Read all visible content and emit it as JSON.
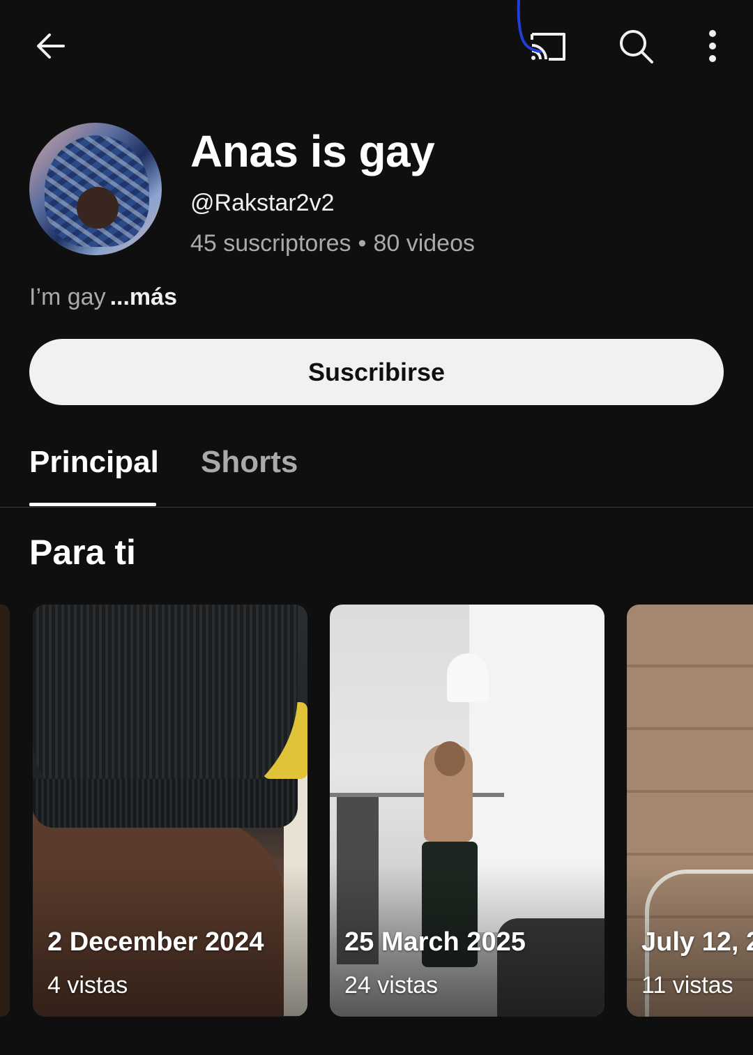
{
  "topbar": {
    "back_icon": "arrow-left-icon",
    "cast_icon": "cast-icon",
    "search_icon": "search-icon",
    "more_icon": "more-vertical-icon"
  },
  "channel": {
    "name": "Anas is gay",
    "handle": "@Rakstar2v2",
    "subscribers": "45 suscriptores",
    "separator": "•",
    "videos": "80 videos",
    "description": "I’m gay",
    "more_label": "...más"
  },
  "subscribe": {
    "label": "Suscribirse"
  },
  "tabs": [
    {
      "label": "Principal",
      "selected": true
    },
    {
      "label": "Shorts",
      "selected": false
    }
  ],
  "section": {
    "title": "Para ti"
  },
  "shorts": [
    {
      "title": "2 December 2024",
      "views": "4 vistas"
    },
    {
      "title": "25 March 2025",
      "views": "24 vistas"
    },
    {
      "title": "July 12, 2",
      "views": "11 vistas"
    }
  ],
  "colors": {
    "background": "#0f0f0f",
    "text_primary": "#f1f1f1",
    "text_secondary": "#aaaaaa",
    "subscribe_bg": "#f1f1f1",
    "subscribe_text": "#0f0f0f"
  }
}
